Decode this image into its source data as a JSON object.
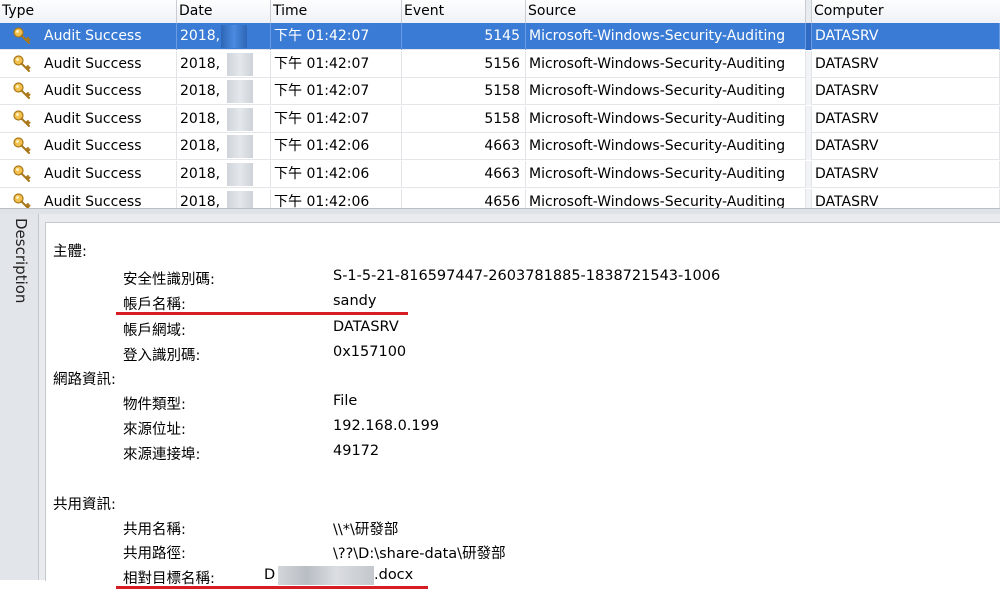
{
  "columns": [
    "Type",
    "Date",
    "Time",
    "Event",
    "Source",
    "Computer"
  ],
  "rows": [
    {
      "type": "Audit Success",
      "date": "2018,",
      "time": "下午 01:42:07",
      "event": "5145",
      "source": "Microsoft-Windows-Security-Auditing",
      "computer": "DATASRV"
    },
    {
      "type": "Audit Success",
      "date": "2018,",
      "time": "下午 01:42:07",
      "event": "5156",
      "source": "Microsoft-Windows-Security-Auditing",
      "computer": "DATASRV"
    },
    {
      "type": "Audit Success",
      "date": "2018,",
      "time": "下午 01:42:07",
      "event": "5158",
      "source": "Microsoft-Windows-Security-Auditing",
      "computer": "DATASRV"
    },
    {
      "type": "Audit Success",
      "date": "2018,",
      "time": "下午 01:42:07",
      "event": "5158",
      "source": "Microsoft-Windows-Security-Auditing",
      "computer": "DATASRV"
    },
    {
      "type": "Audit Success",
      "date": "2018,",
      "time": "下午 01:42:06",
      "event": "4663",
      "source": "Microsoft-Windows-Security-Auditing",
      "computer": "DATASRV"
    },
    {
      "type": "Audit Success",
      "date": "2018,",
      "time": "下午 01:42:06",
      "event": "4663",
      "source": "Microsoft-Windows-Security-Auditing",
      "computer": "DATASRV"
    },
    {
      "type": "Audit Success",
      "date": "2018,",
      "time": "下午 01:42:06",
      "event": "4656",
      "source": "Microsoft-Windows-Security-Auditing",
      "computer": "DATASRV"
    }
  ],
  "selected_row": 0,
  "row_icon": "key-icon",
  "description": {
    "tab_label": "Description",
    "subject_heading": "主體:",
    "sid_label": "安全性識別碼:",
    "sid_value": "S-1-5-21-816597447-2603781885-1838721543-1006",
    "account_name_label": "帳戶名稱:",
    "account_name_value": "sandy",
    "account_domain_label": "帳戶網域:",
    "account_domain_value": "DATASRV",
    "logon_id_label": "登入識別碼:",
    "logon_id_value": "0x157100",
    "network_heading": "網路資訊:",
    "object_type_label": "物件類型:",
    "object_type_value": "File",
    "source_address_label": "來源位址:",
    "source_address_value": "192.168.0.199",
    "source_port_label": "來源連接埠:",
    "source_port_value": "49172",
    "share_heading": "共用資訊:",
    "share_name_label": "共用名稱:",
    "share_name_value": "\\\\*\\研發部",
    "share_path_label": "共用路徑:",
    "share_path_value": "\\??\\D:\\share-data\\研發部",
    "relative_target_label": "相對目標名稱:",
    "relative_target_prefix": "D",
    "relative_target_suffix": ".docx"
  },
  "colors": {
    "selection": "#3a7bd5",
    "highlight_underline": "#d71d23"
  }
}
